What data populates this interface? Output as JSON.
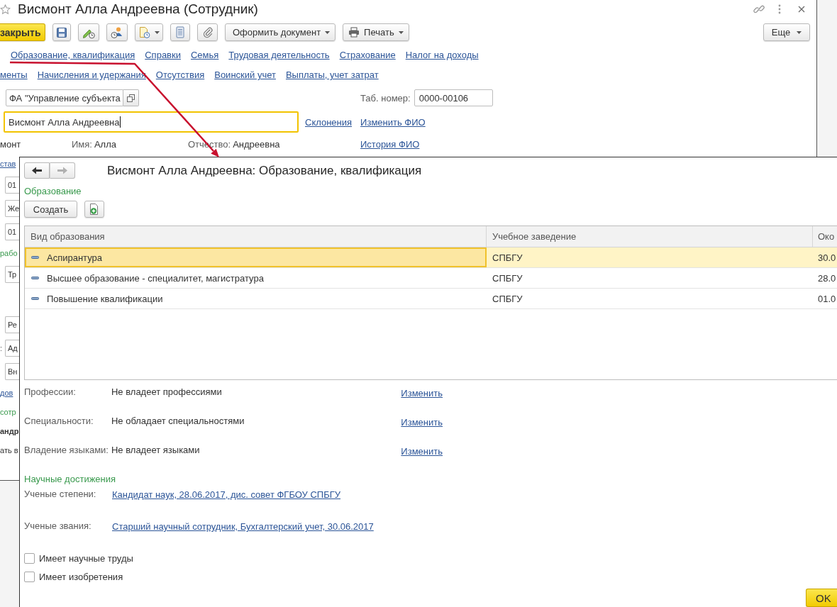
{
  "main_window": {
    "title": "Висмонт Алла Андреевна (Сотрудник)",
    "toolbar": {
      "save_close_button": "закрыть",
      "document_button": "Оформить документ",
      "print_button": "Печать",
      "more_button": "Еще"
    },
    "link_rows": [
      {
        "links": [
          "Образование, квалификация",
          "Справки",
          "Семья",
          "Трудовая деятельность",
          "Страхование",
          "Налог на доходы"
        ]
      },
      {
        "links": [
          "менты",
          "Начисления и удержания",
          "Отсутствия",
          "Воинский учет",
          "Выплаты, учет затрат"
        ]
      }
    ],
    "organization_field": {
      "value": "ФА \"Управление субъекта"
    },
    "tab_number": {
      "label": "Таб. номер:",
      "value": "0000-00106"
    },
    "full_name_field": {
      "value": "Висмонт Алла Андреевна",
      "focused": true
    },
    "full_name_links": [
      "Склонения",
      "Изменить ФИО"
    ],
    "surname": {
      "value": "монт"
    },
    "first_name": {
      "label": "Имя:",
      "value": "Алла"
    },
    "patronymic": {
      "label": "Отчество:",
      "value": "Андреевна"
    },
    "history_link": "История ФИО",
    "left_edge_items": [
      {
        "kind": "link",
        "text": "став"
      },
      {
        "kind": "field",
        "value": "01"
      },
      {
        "kind": "field",
        "value": "Же"
      },
      {
        "kind": "field",
        "value": "01"
      },
      {
        "kind": "heading",
        "text": "рабо"
      },
      {
        "kind": "field",
        "value": "Тр"
      },
      {
        "kind": "field",
        "value": "Ре"
      },
      {
        "kind": "field",
        "label": ":",
        "value": "Ад"
      },
      {
        "kind": "field",
        "value": "Вн"
      },
      {
        "kind": "link",
        "text": "дов"
      },
      {
        "kind": "heading",
        "text": "сотр"
      },
      {
        "kind": "bold",
        "text": "андр"
      },
      {
        "kind": "text",
        "text": "ать в"
      }
    ]
  },
  "dialog": {
    "navigation": [
      {
        "kind": "back",
        "disabled": false
      },
      {
        "kind": "forward",
        "disabled": true
      }
    ],
    "title": "Висмонт Алла Андреевна: Образование, квалификация",
    "education": {
      "heading": "Образование",
      "create_button": "Создать",
      "table": {
        "columns": [
          "Вид образования",
          "Учебное заведение",
          "Око"
        ],
        "rows": [
          {
            "cells": [
              "Аспирантура",
              "СПБГУ",
              "30.0"
            ],
            "selected": true
          },
          {
            "cells": [
              "Высшее образование - специалитет, магистратура",
              "СПБГУ",
              "28.0"
            ],
            "selected": false
          },
          {
            "cells": [
              "Повышение квалификации",
              "СПБГУ",
              "01.0"
            ],
            "selected": false
          }
        ]
      }
    },
    "qualifications": [
      {
        "label": "Профессии:",
        "value": "Не владеет профессиями",
        "link": "Изменить"
      },
      {
        "label": "Специальности:",
        "value": "Не обладает специальностями",
        "link": "Изменить"
      },
      {
        "label": "Владение языками:",
        "value": "Не владеет языками",
        "link": "Изменить"
      }
    ],
    "achievements": {
      "heading": "Научные достижения",
      "items": [
        {
          "label": "Ученые степени:",
          "link": "Кандидат наук, 28.06.2017, дис. совет ФГБОУ СПБГУ"
        },
        {
          "label": "Ученые звания:",
          "link": "Старший научный сотрудник, Бухгалтерский учет, 30.06.2017"
        }
      ]
    },
    "checkboxes": [
      {
        "label": "Имеет научные труды",
        "checked": false
      },
      {
        "label": "Имеет изобретения",
        "checked": false
      }
    ],
    "ok_button": "OK"
  }
}
